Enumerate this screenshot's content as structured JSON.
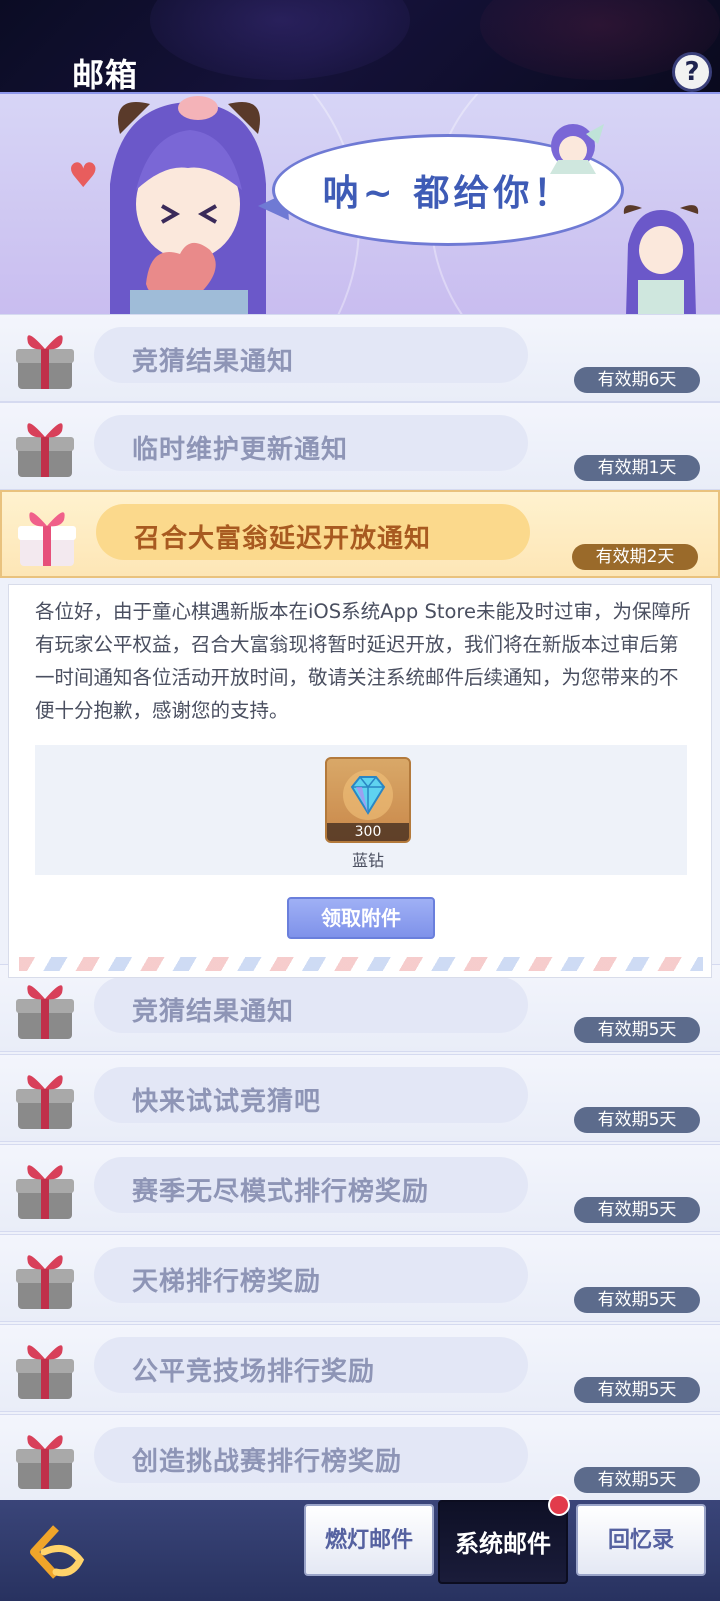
{
  "header": {
    "title": "邮箱",
    "help_label": "?"
  },
  "banner": {
    "speech": "呐~ 都给你！"
  },
  "mails": [
    {
      "subject": "竞猜结果通知",
      "expiry": "有效期6天",
      "active": false
    },
    {
      "subject": "临时维护更新通知",
      "expiry": "有效期1天",
      "active": false
    },
    {
      "subject": "召合大富翁延迟开放通知",
      "expiry": "有效期2天",
      "active": true
    },
    {
      "subject": "竞猜结果通知",
      "expiry": "有效期5天",
      "active": false
    },
    {
      "subject": "快来试试竞猜吧",
      "expiry": "有效期5天",
      "active": false
    },
    {
      "subject": "赛季无尽模式排行榜奖励",
      "expiry": "有效期5天",
      "active": false
    },
    {
      "subject": "天梯排行榜奖励",
      "expiry": "有效期5天",
      "active": false
    },
    {
      "subject": "公平竞技场排行奖励",
      "expiry": "有效期5天",
      "active": false
    },
    {
      "subject": "创造挑战赛排行榜奖励",
      "expiry": "有效期5天",
      "active": false
    }
  ],
  "detail": {
    "body": "各位好，由于童心棋遇新版本在iOS系统App Store未能及时过审，为保障所有玩家公平权益，召合大富翁现将暂时延迟开放，我们将在新版本过审后第一时间通知各位活动开放时间，敬请关注系统邮件后续通知，为您带来的不便十分抱歉，感谢您的支持。",
    "attachment": {
      "name": "蓝钻",
      "count": "300",
      "icon": "blue-diamond-icon"
    },
    "claim_label": "领取附件"
  },
  "tabs": [
    {
      "label": "燃灯邮件",
      "active": false
    },
    {
      "label": "系统邮件",
      "active": true
    },
    {
      "label": "回忆录",
      "active": false
    }
  ],
  "colors": {
    "accent": "#7f92ea",
    "active_row": "#fde6b6",
    "expiry_badge": "#5c6b8c",
    "notification_dot": "#e23b4b"
  }
}
